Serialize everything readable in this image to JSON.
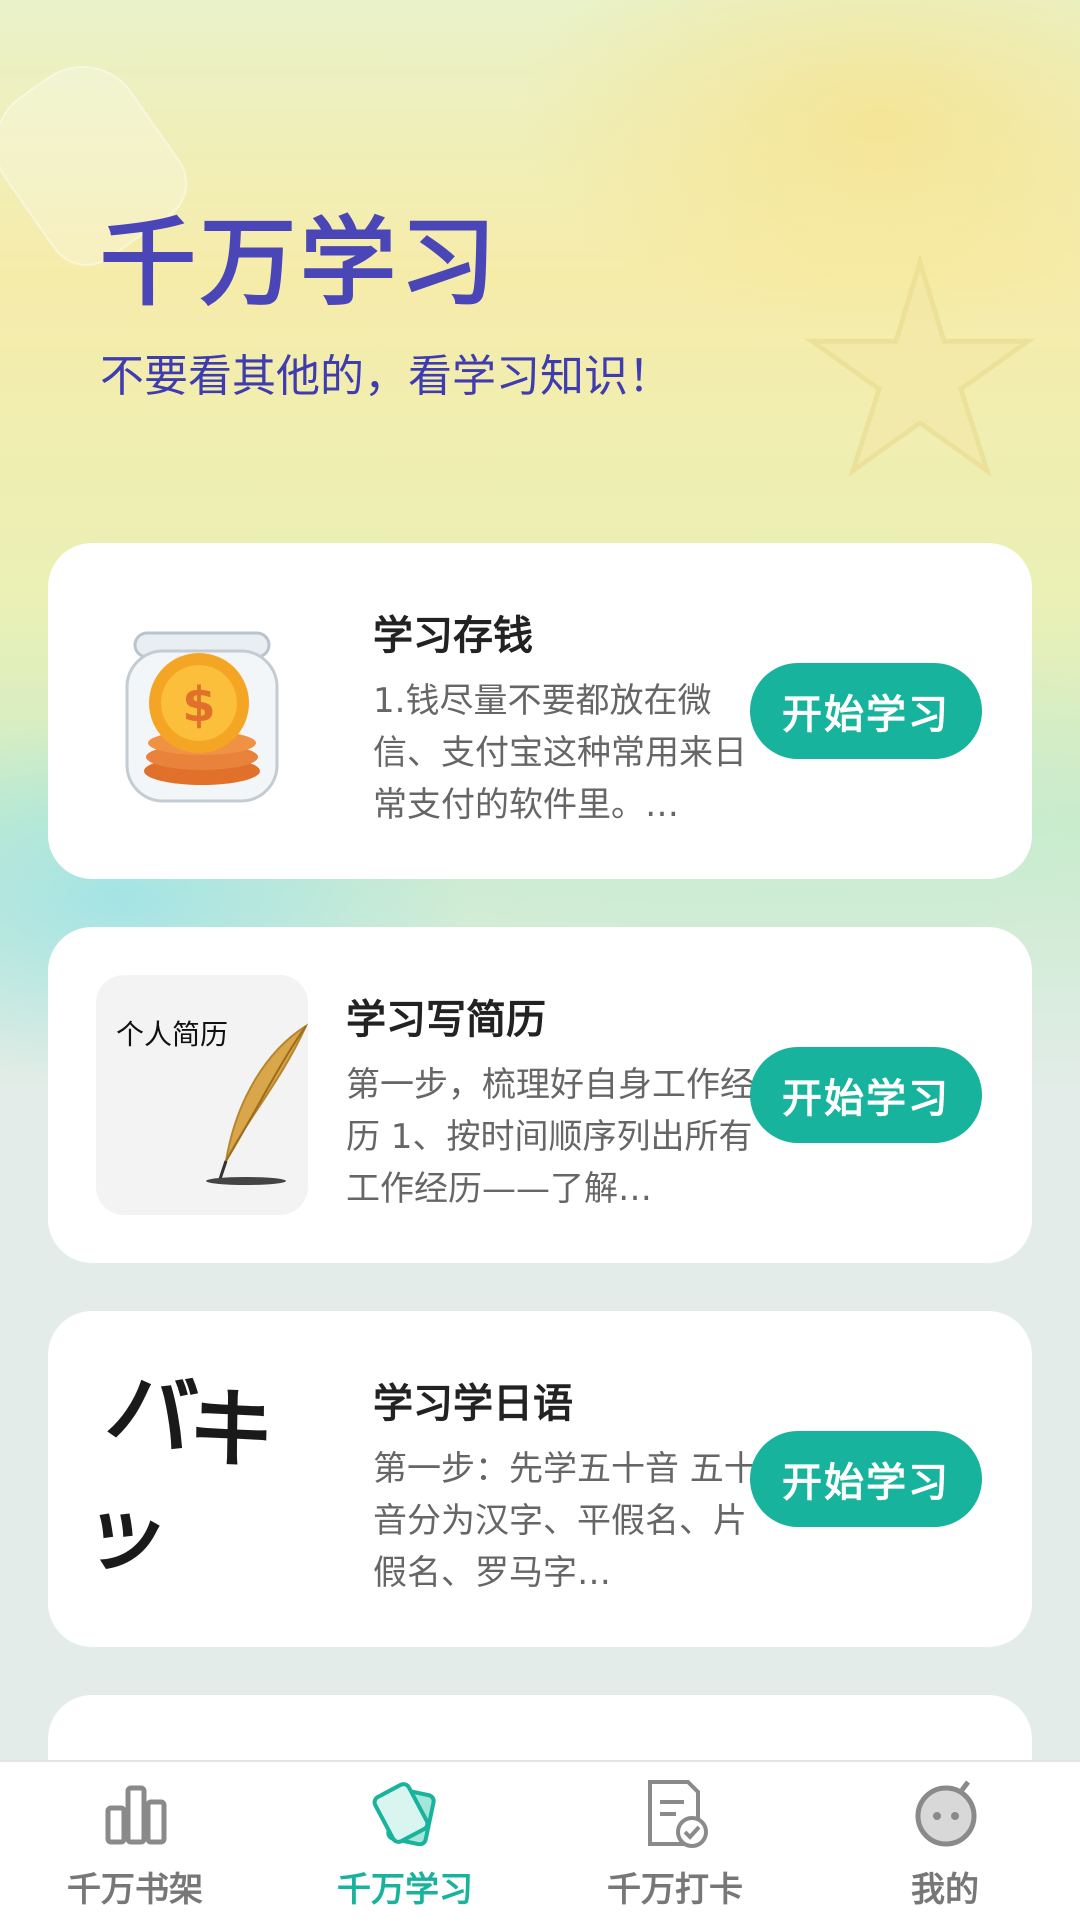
{
  "header": {
    "title": "千万学习",
    "subtitle": "不要看其他的，看学习知识！"
  },
  "cards": [
    {
      "title": "学习存钱",
      "desc": "1.钱尽量不要都放在微信、支付宝这种常用来日常支付的软件里。…",
      "button": "开始学习",
      "image_icon": "coin-jar-icon"
    },
    {
      "title": "学习写简历",
      "desc": "第一步，梳理好自身工作经历 1、按时间顺序列出所有工作经历——了解…",
      "button": "开始学习",
      "image_label": "个人简历",
      "image_icon": "quill-pen-icon"
    },
    {
      "title": "学习学日语",
      "desc": "第一步：先学五十音 五十音分为汉字、平假名、片假名、罗马字…",
      "button": "开始学习",
      "image_text": "バキッ"
    }
  ],
  "tabbar": {
    "items": [
      {
        "label": "千万书架",
        "icon": "bookshelf-icon",
        "active": false
      },
      {
        "label": "千万学习",
        "icon": "cards-icon",
        "active": true
      },
      {
        "label": "千万打卡",
        "icon": "checkin-doc-icon",
        "active": false
      },
      {
        "label": "我的",
        "icon": "profile-face-icon",
        "active": false
      }
    ]
  },
  "colors": {
    "accent": "#17b39c",
    "title": "#4a46b8",
    "inactive_tab": "#777777"
  }
}
